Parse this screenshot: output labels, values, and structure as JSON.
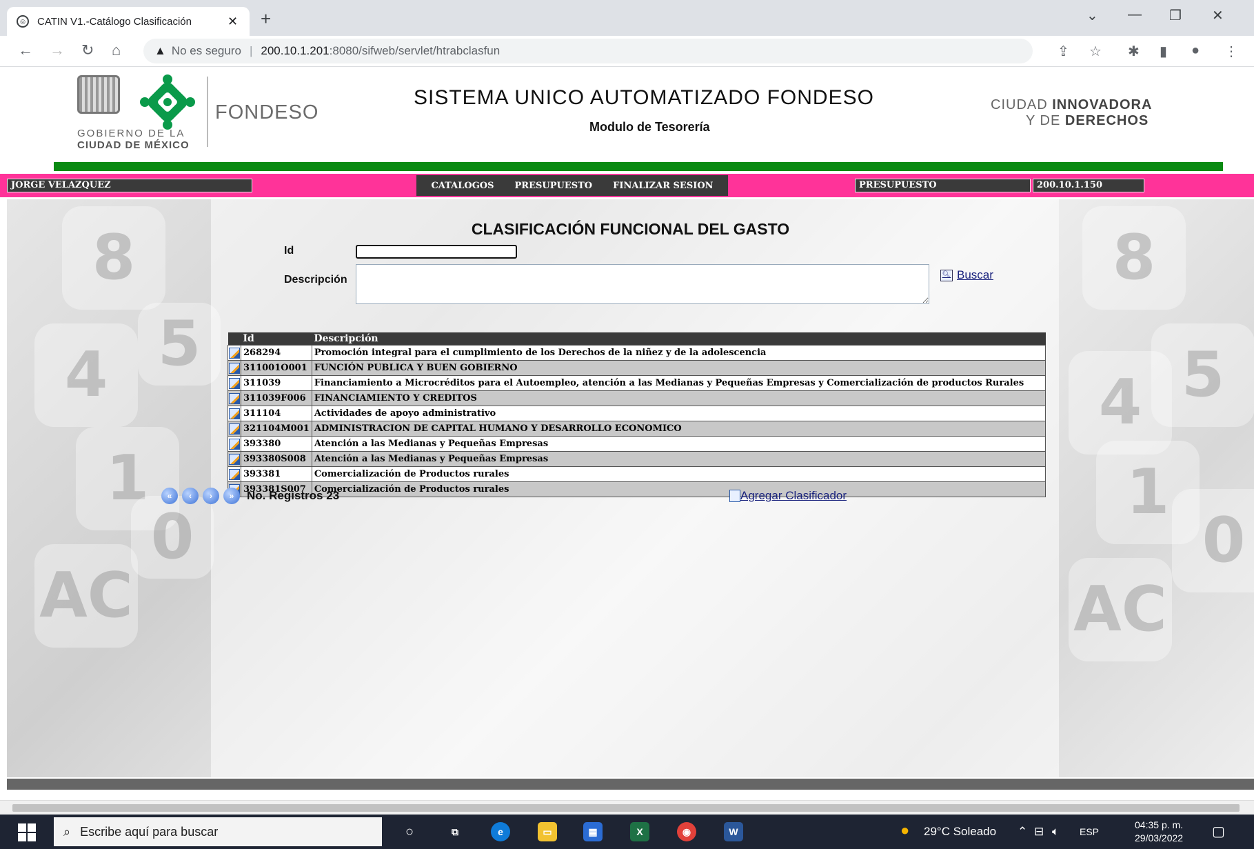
{
  "browser": {
    "tab_title": "CATIN V1.-Catálogo Clasificación",
    "tab_close": "✕",
    "new_tab": "+",
    "security_warning": "No es seguro",
    "url_host": "200.10.1.201",
    "url_rest": ":8080/sifweb/servlet/htrabclasfun"
  },
  "header": {
    "gobierno_line1": "GOBIERNO DE LA",
    "gobierno_line2": "CIUDAD DE MÉXICO",
    "fondeso": "FONDESO",
    "system_title": "SISTEMA UNICO AUTOMATIZADO FONDESO",
    "module": "Modulo de Tesorería",
    "slogan_a": "CIUDAD ",
    "slogan_b": "INNOVADORA",
    "slogan_c": "Y DE ",
    "slogan_d": "DERECHOS"
  },
  "menubar": {
    "user": "JORGE VELAZQUEZ",
    "items": [
      "CATALOGOS",
      "PRESUPUESTO",
      "FINALIZAR SESION"
    ],
    "area": "PRESUPUESTO",
    "ip": "200.10.1.150"
  },
  "main": {
    "title": "CLASIFICACIÓN FUNCIONAL DEL GASTO",
    "id_label": "Id",
    "desc_label": "Descripción",
    "id_value": "",
    "desc_value": "",
    "buscar": "Buscar",
    "agregar": "Agregar Clasificador",
    "registros": "No. Registros 23"
  },
  "table": {
    "headers": [
      "Id",
      "Descripción"
    ],
    "rows": [
      {
        "id": "268294",
        "desc": "Promoción integral para el cumplimiento de los Derechos de la niñez y de la adolescencia"
      },
      {
        "id": "311001O001",
        "desc": "FUNCIÓN PUBLICA Y BUEN GOBIERNO"
      },
      {
        "id": "311039",
        "desc": "Financiamiento a Microcréditos para el Autoempleo, atención a las Medianas y Pequeñas Empresas y Comercialización de productos Rurales"
      },
      {
        "id": "311039F006",
        "desc": "FINANCIAMIENTO Y CREDITOS"
      },
      {
        "id": "311104",
        "desc": "Actividades de apoyo administrativo"
      },
      {
        "id": "321104M001",
        "desc": "ADMINISTRACION DE CAPITAL HUMANO Y DESARROLLO ECONOMICO"
      },
      {
        "id": "393380",
        "desc": "Atención a las Medianas y Pequeñas Empresas"
      },
      {
        "id": "393380S008",
        "desc": "Atención a las Medianas y Pequeñas Empresas"
      },
      {
        "id": "393381",
        "desc": "Comercialización de Productos rurales"
      },
      {
        "id": "393381S007",
        "desc": "Comercialización de Productos rurales"
      }
    ]
  },
  "taskbar": {
    "search_placeholder": "Escribe aquí para buscar",
    "weather": "29°C  Soleado",
    "lang": "ESP",
    "time": "04:35 p. m.",
    "date": "29/03/2022"
  },
  "colors": {
    "menubar": "#ff3399",
    "greenbar": "#0a8a12",
    "grid_header": "#3a3a3a"
  }
}
